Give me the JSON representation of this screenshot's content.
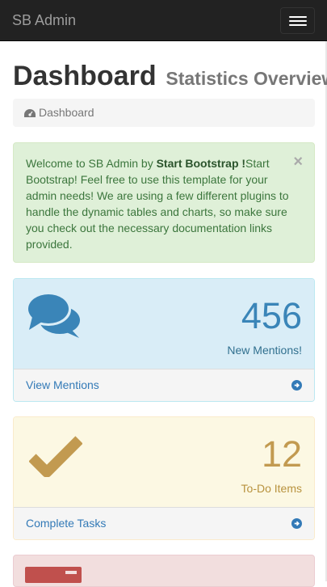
{
  "navbar": {
    "brand": "SB Admin",
    "toggle_icon": "hamburger-icon"
  },
  "header": {
    "title": "Dashboard",
    "subtitle": "Statistics Overview"
  },
  "breadcrumb": {
    "icon": "dashboard-gauge-icon",
    "label": "Dashboard"
  },
  "alert": {
    "text_before": "Welcome to SB Admin by ",
    "bold_link": "Start Bootstrap !",
    "text_after": "Start Bootstrap! Feel free to use this template for your admin needs! We are using a few different plugins to handle the dynamic tables and charts, so make sure you check out the necessary documentation links provided.",
    "close_symbol": "×"
  },
  "panels": [
    {
      "icon": "comments-icon",
      "value": "456",
      "label": "New Mentions!",
      "link": "View Mentions",
      "link_icon": "arrow-circle-right-icon",
      "color": "#31708f"
    },
    {
      "icon": "check-icon",
      "value": "12",
      "label": "To-Do Items",
      "link": "Complete Tasks",
      "link_icon": "arrow-circle-right-icon",
      "color": "#8a6d3b"
    },
    {
      "icon": "shopping-cart-icon",
      "color": "#a94442"
    }
  ]
}
